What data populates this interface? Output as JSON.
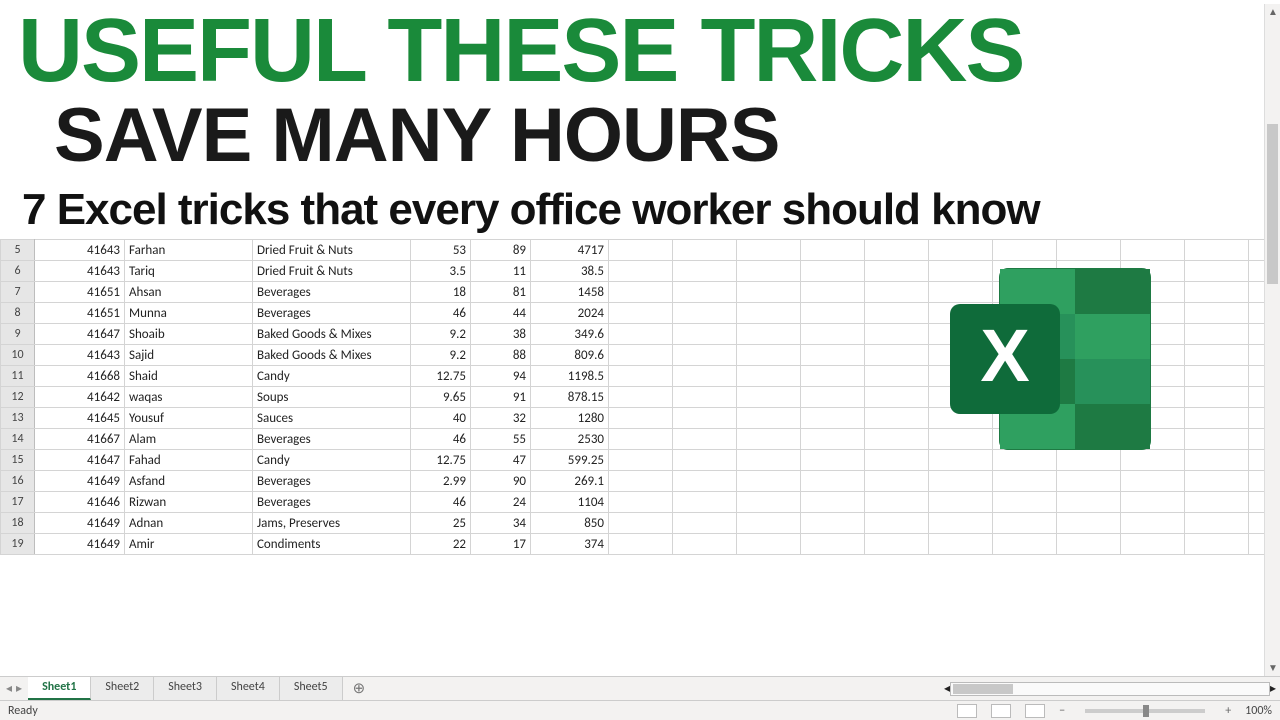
{
  "overlay": {
    "line1": "USEFUL THESE TRICKS",
    "line2": "SAVE MANY HOURS",
    "line3": "7 Excel tricks that every office worker should know"
  },
  "icon_name": "excel-logo-icon",
  "rows": [
    {
      "n": 5,
      "a": "41643",
      "b": "Farhan",
      "c": "Dried Fruit & Nuts",
      "d": "53",
      "e": "89",
      "f": "4717"
    },
    {
      "n": 6,
      "a": "41643",
      "b": "Tariq",
      "c": "Dried Fruit & Nuts",
      "d": "3.5",
      "e": "11",
      "f": "38.5"
    },
    {
      "n": 7,
      "a": "41651",
      "b": "Ahsan",
      "c": "Beverages",
      "d": "18",
      "e": "81",
      "f": "1458"
    },
    {
      "n": 8,
      "a": "41651",
      "b": "Munna",
      "c": "Beverages",
      "d": "46",
      "e": "44",
      "f": "2024"
    },
    {
      "n": 9,
      "a": "41647",
      "b": "Shoaib",
      "c": "Baked Goods & Mixes",
      "d": "9.2",
      "e": "38",
      "f": "349.6"
    },
    {
      "n": 10,
      "a": "41643",
      "b": "Sajid",
      "c": "Baked Goods & Mixes",
      "d": "9.2",
      "e": "88",
      "f": "809.6"
    },
    {
      "n": 11,
      "a": "41668",
      "b": "Shaid",
      "c": "Candy",
      "d": "12.75",
      "e": "94",
      "f": "1198.5"
    },
    {
      "n": 12,
      "a": "41642",
      "b": "waqas",
      "c": "Soups",
      "d": "9.65",
      "e": "91",
      "f": "878.15"
    },
    {
      "n": 13,
      "a": "41645",
      "b": "Yousuf",
      "c": "Sauces",
      "d": "40",
      "e": "32",
      "f": "1280"
    },
    {
      "n": 14,
      "a": "41667",
      "b": "Alam",
      "c": "Beverages",
      "d": "46",
      "e": "55",
      "f": "2530"
    },
    {
      "n": 15,
      "a": "41647",
      "b": "Fahad",
      "c": "Candy",
      "d": "12.75",
      "e": "47",
      "f": "599.25"
    },
    {
      "n": 16,
      "a": "41649",
      "b": "Asfand",
      "c": "Beverages",
      "d": "2.99",
      "e": "90",
      "f": "269.1"
    },
    {
      "n": 17,
      "a": "41646",
      "b": "Rizwan",
      "c": "Beverages",
      "d": "46",
      "e": "24",
      "f": "1104"
    },
    {
      "n": 18,
      "a": "41649",
      "b": "Adnan",
      "c": "Jams, Preserves",
      "d": "25",
      "e": "34",
      "f": "850"
    },
    {
      "n": 19,
      "a": "41649",
      "b": "Amir",
      "c": "Condiments",
      "d": "22",
      "e": "17",
      "f": "374"
    }
  ],
  "tabs": {
    "items": [
      "Sheet1",
      "Sheet2",
      "Sheet3",
      "Sheet4",
      "Sheet5"
    ],
    "active": "Sheet1",
    "add_glyph": "⊕"
  },
  "nav": {
    "prev": "◂",
    "next": "▸"
  },
  "status": {
    "ready": "Ready",
    "zoom": "100%",
    "minus": "−",
    "plus": "+"
  }
}
